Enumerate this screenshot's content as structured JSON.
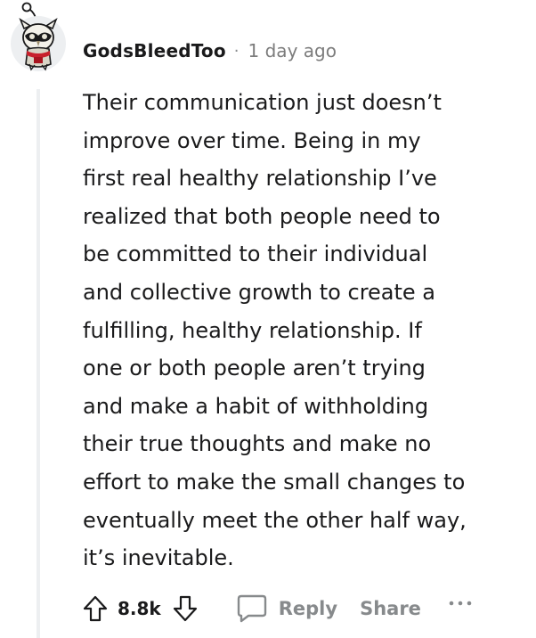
{
  "comment": {
    "author": "GodsBleedToo",
    "separator": "·",
    "timestamp": "1 day ago",
    "body_lines": [
      "Their communication just doesn’t",
      "improve over time. Being in my",
      "first real healthy relationship I’ve",
      "realized that both people need to",
      "be committed to their individual",
      "and collective growth to create a",
      "fulfilling, healthy relationship. If",
      "one or both people aren’t trying",
      "and make a habit of withholding",
      "their true thoughts and make no",
      "effort to make the small changes to",
      "eventually meet the other half way,",
      "it’s inevitable."
    ]
  },
  "actions": {
    "score": "8.8k",
    "reply_label": "Reply",
    "share_label": "Share",
    "icons": {
      "upvote": "upvote-arrow-icon",
      "downvote": "downvote-arrow-icon",
      "reply": "speech-bubble-icon",
      "more": "ellipsis-icon"
    }
  },
  "colors": {
    "text": "#1a1a1b",
    "muted": "#878a8c",
    "thread_line": "#edeff1"
  }
}
